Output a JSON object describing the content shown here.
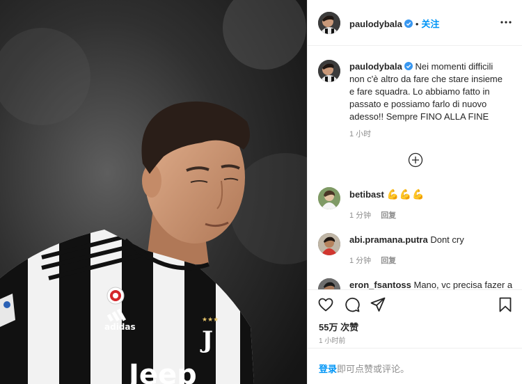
{
  "post": {
    "photo_alt": "photo",
    "header": {
      "username": "paulodybala",
      "separator": "•",
      "follow_label": "关注"
    },
    "caption": {
      "username": "paulodybala",
      "text": "Nei momenti difficili non c'è altro da fare che stare insieme e fare squadra. Lo abbiamo fatto in passato e possiamo farlo di nuovo adesso!! Sempre FINO ALLA FINE",
      "time": "1 小时"
    },
    "comments": [
      {
        "username": "betibast",
        "text": "💪💪💪",
        "time": "1 分钟",
        "reply_label": "回复"
      },
      {
        "username": "abi.pramana.putra",
        "text": "Dont cry",
        "time": "1 分钟",
        "reply_label": "回复"
      },
      {
        "username": "eron_fsantoss",
        "text": "Mano, vc precisa fazer a",
        "time": "",
        "reply_label": ""
      }
    ],
    "likes_label": "55万 次赞",
    "timestamp": "1 小时前",
    "login_prompt": {
      "link": "登录",
      "rest": "即可点赞或评论。"
    },
    "colors": {
      "link": "#0095f6",
      "verified": "#3897f0",
      "text": "#262626",
      "secondary": "#8e8e8e"
    }
  }
}
